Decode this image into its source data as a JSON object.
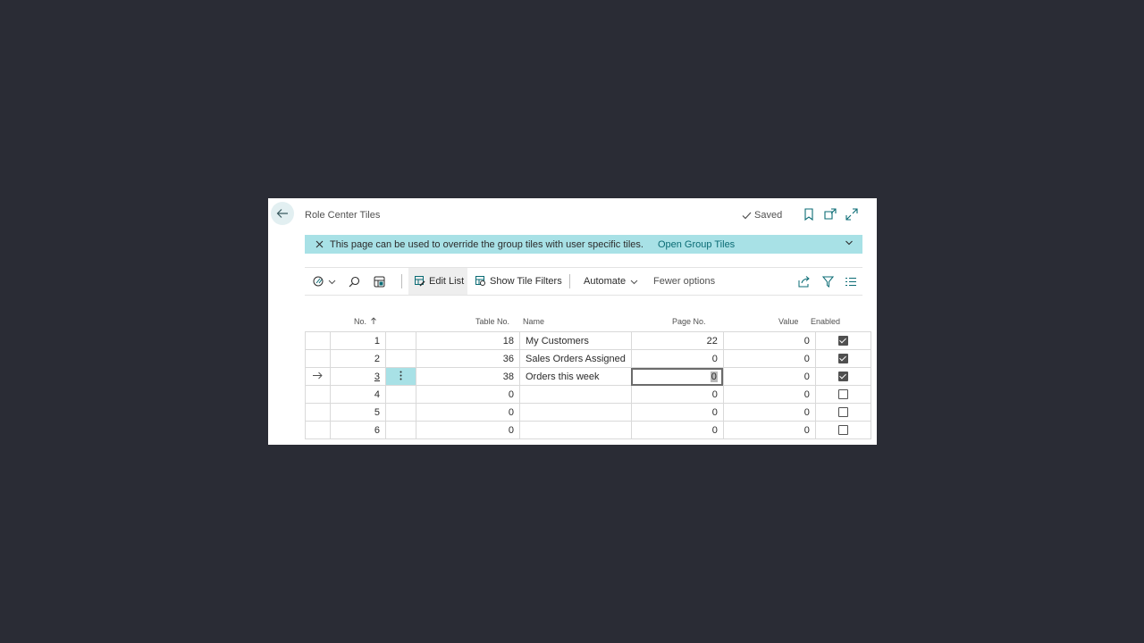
{
  "header": {
    "title": "Role Center Tiles",
    "saved_label": "Saved"
  },
  "banner": {
    "message": "This page can be used to override the group tiles with user specific tiles.",
    "link": "Open Group Tiles"
  },
  "toolbar": {
    "edit_list": "Edit List",
    "show_tile_filters": "Show Tile Filters",
    "automate": "Automate",
    "fewer_options": "Fewer options"
  },
  "columns": {
    "no": "No.",
    "table_no": "Table No.",
    "name": "Name",
    "page_no": "Page No.",
    "value": "Value",
    "enabled": "Enabled"
  },
  "rows": [
    {
      "no": "1",
      "table_no": "18",
      "name": "My Customers",
      "page_no": "22",
      "value": "0",
      "enabled": true
    },
    {
      "no": "2",
      "table_no": "36",
      "name": "Sales Orders Assigned",
      "page_no": "0",
      "value": "0",
      "enabled": true
    },
    {
      "no": "3",
      "table_no": "38",
      "name": "Orders this week",
      "page_no": "0",
      "value": "0",
      "enabled": true
    },
    {
      "no": "4",
      "table_no": "0",
      "name": "",
      "page_no": "0",
      "value": "0",
      "enabled": false
    },
    {
      "no": "5",
      "table_no": "0",
      "name": "",
      "page_no": "0",
      "value": "0",
      "enabled": false
    },
    {
      "no": "6",
      "table_no": "0",
      "name": "",
      "page_no": "0",
      "value": "0",
      "enabled": false
    }
  ],
  "colors": {
    "background": "#2a2c35",
    "accent": "#a8e1e6",
    "link": "#0a6b74"
  }
}
